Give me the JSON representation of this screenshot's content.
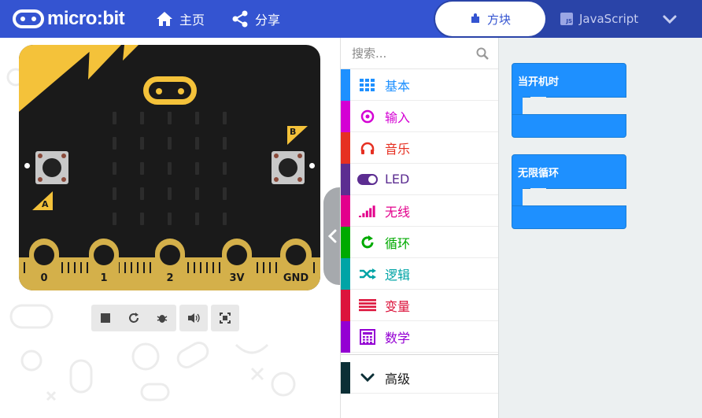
{
  "header": {
    "logo_text": "micro:bit",
    "nav_home": "主页",
    "nav_share": "分享",
    "tab_blocks": "方块",
    "tab_javascript": "JavaScript",
    "js_badge": "JS"
  },
  "simulator": {
    "button_a": "A",
    "button_b": "B",
    "pins": [
      "0",
      "1",
      "2",
      "3V",
      "GND"
    ]
  },
  "toolbox": {
    "search_placeholder": "搜索...",
    "categories": [
      {
        "label": "基本",
        "color": "#1e90ff",
        "icon": "grid-icon"
      },
      {
        "label": "输入",
        "color": "#d400d4",
        "icon": "target-icon"
      },
      {
        "label": "音乐",
        "color": "#e63022",
        "icon": "headphones-icon"
      },
      {
        "label": "LED",
        "color": "#5c2d91",
        "icon": "toggle-icon"
      },
      {
        "label": "无线",
        "color": "#e3008c",
        "icon": "signal-icon"
      },
      {
        "label": "循环",
        "color": "#00aa00",
        "icon": "refresh-icon"
      },
      {
        "label": "逻辑",
        "color": "#00a4a6",
        "icon": "shuffle-icon"
      },
      {
        "label": "变量",
        "color": "#dc143c",
        "icon": "lines-icon"
      },
      {
        "label": "数学",
        "color": "#9400d3",
        "icon": "calculator-icon"
      }
    ],
    "advanced": "高级"
  },
  "workspace": {
    "blocks": [
      {
        "title": "当开机时"
      },
      {
        "title": "无限循环"
      }
    ]
  }
}
